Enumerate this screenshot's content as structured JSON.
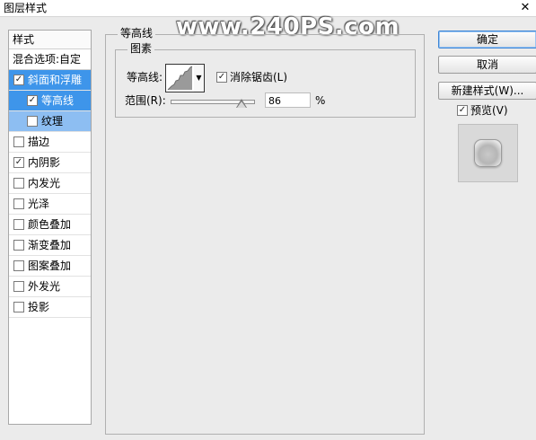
{
  "window": {
    "title": "图层样式",
    "close_symbol": "✕"
  },
  "watermark": "www.240PS.com",
  "sidebar": {
    "header": "样式",
    "blend_options": "混合选项:自定",
    "items": [
      {
        "label": "斜面和浮雕",
        "checked": true,
        "selected": true,
        "level": 0
      },
      {
        "label": "等高线",
        "checked": true,
        "selected": true,
        "level": 1
      },
      {
        "label": "纹理",
        "checked": false,
        "selected": false,
        "level": 1
      },
      {
        "label": "描边",
        "checked": false,
        "selected": false,
        "level": 0
      },
      {
        "label": "内阴影",
        "checked": true,
        "selected": false,
        "level": 0
      },
      {
        "label": "内发光",
        "checked": false,
        "selected": false,
        "level": 0
      },
      {
        "label": "光泽",
        "checked": false,
        "selected": false,
        "level": 0
      },
      {
        "label": "颜色叠加",
        "checked": false,
        "selected": false,
        "level": 0
      },
      {
        "label": "渐变叠加",
        "checked": false,
        "selected": false,
        "level": 0
      },
      {
        "label": "图案叠加",
        "checked": false,
        "selected": false,
        "level": 0
      },
      {
        "label": "外发光",
        "checked": false,
        "selected": false,
        "level": 0
      },
      {
        "label": "投影",
        "checked": false,
        "selected": false,
        "level": 0
      }
    ]
  },
  "main": {
    "group_title": "等高线",
    "subgroup_title": "图素",
    "contour_label": "等高线:",
    "antialias_label": "消除锯齿(L)",
    "antialias_checked": true,
    "range_label": "范围(R):",
    "range_value": "86",
    "range_unit": "%",
    "range_fraction": 0.86
  },
  "buttons": {
    "ok": "确定",
    "cancel": "取消",
    "new_style": "新建样式(W)...",
    "preview_label": "预览(V)",
    "preview_checked": true
  },
  "check_glyph": "✓"
}
